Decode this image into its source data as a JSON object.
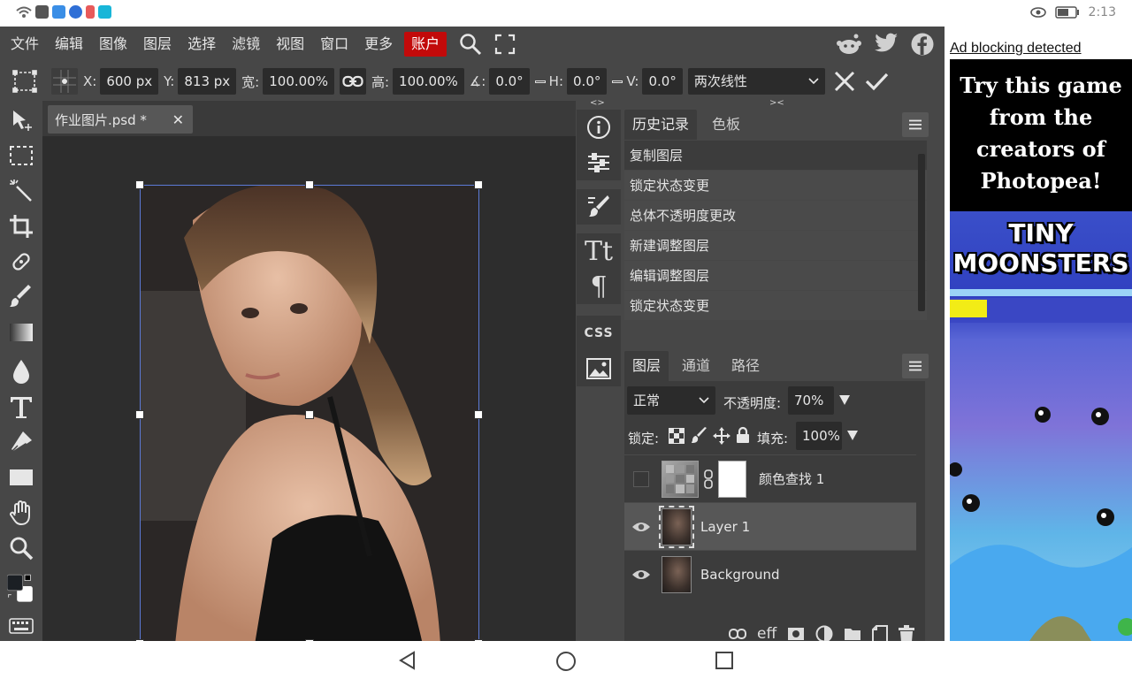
{
  "status_bar": {
    "time": "2:13"
  },
  "menu": {
    "items": [
      "文件",
      "编辑",
      "图像",
      "图层",
      "选择",
      "滤镜",
      "视图",
      "窗口",
      "更多"
    ],
    "account": "账户"
  },
  "options": {
    "x_label": "X:",
    "x_value": "600 px",
    "y_label": "Y:",
    "y_value": "813 px",
    "width_label": "宽:",
    "width_value": "100.00%",
    "height_label": "高:",
    "height_value": "100.00%",
    "angle_label": "∡:",
    "angle_value": "0.0°",
    "h_label": "H:",
    "h_value": "0.0°",
    "v_label": "V:",
    "v_value": "0.0°",
    "interpolation": "两次线性"
  },
  "document": {
    "tab_title": "作业图片.psd *",
    "close_glyph": "✕"
  },
  "strip": {
    "top_marker_left": "<>",
    "top_marker_right": "><",
    "css_label": "CSS"
  },
  "history_panel": {
    "tabs": [
      "历史记录",
      "色板"
    ],
    "items": [
      "复制图层",
      "锁定状态变更",
      "总体不透明度更改",
      "新建调整图层",
      "编辑调整图层",
      "锁定状态变更"
    ]
  },
  "layers_panel": {
    "tabs": [
      "图层",
      "通道",
      "路径"
    ],
    "blend_mode": "正常",
    "opacity_label": "不透明度:",
    "opacity_value": "70%",
    "lock_label": "锁定:",
    "fill_label": "填充:",
    "fill_value": "100%",
    "layers": [
      {
        "name": "颜色查找 1",
        "visible": false,
        "type": "adjustment"
      },
      {
        "name": "Layer 1",
        "visible": true,
        "selected": true
      },
      {
        "name": "Background",
        "visible": true
      }
    ],
    "footer_eff": "eff"
  },
  "ad": {
    "notice": "Ad blocking detected",
    "headline": "Try this game from the creators of Photopea!",
    "game_title_1": "TINY",
    "game_title_2": "MOONSTERS"
  },
  "colors": {
    "accent_account": "#c20a0a",
    "selection": "#5c7ad6",
    "panel_bg": "#474747",
    "canvas_bg": "#2d2d2d"
  }
}
